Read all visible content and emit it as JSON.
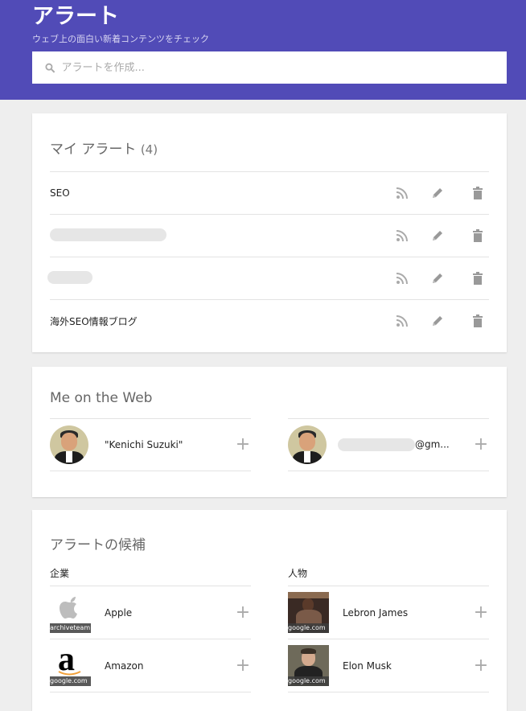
{
  "header": {
    "title": "アラート",
    "subtitle": "ウェブ上の面白い新着コンテンツをチェック",
    "search_placeholder": "アラートを作成..."
  },
  "my_alerts": {
    "title": "マイ アラート",
    "count": "(4)",
    "items": [
      {
        "label": "SEO"
      },
      {
        "label": ""
      },
      {
        "label": ""
      },
      {
        "label": "海外SEO情報ブログ"
      }
    ]
  },
  "me_on_web": {
    "title": "Me on the Web",
    "items": [
      {
        "label": "\"Kenichi Suzuki\""
      },
      {
        "label": "@gm..."
      }
    ]
  },
  "suggestions": {
    "title": "アラートの候補",
    "companies": {
      "heading": "企業",
      "items": [
        {
          "label": "Apple",
          "caption": "archiveteam"
        },
        {
          "label": "Amazon",
          "caption": "google.com"
        }
      ]
    },
    "people": {
      "heading": "人物",
      "items": [
        {
          "label": "Lebron James",
          "caption": "google.com"
        },
        {
          "label": "Elon Musk",
          "caption": "google.com"
        }
      ]
    }
  },
  "colors": {
    "header_bg": "#514bb7",
    "page_bg": "#eeeeee",
    "icon_gray": "#aaaaaa"
  }
}
